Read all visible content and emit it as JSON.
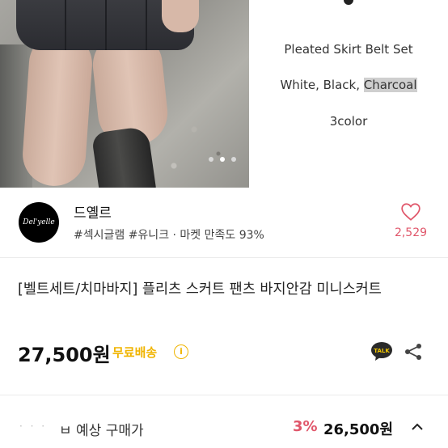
{
  "hero": {
    "info_line1": "Pleated Skirt Belt Set",
    "info_line2_prefix": "White, Black, ",
    "info_line2_highlight": "Charcoal",
    "info_line3": "3color",
    "carousel_dots": 3,
    "carousel_active_index": 1
  },
  "shop": {
    "avatar_text": "Del'yelle",
    "name": "드옐르",
    "tags": "#섹시글램 #유니크 · 마켓 만족도 93%",
    "like_count": "2,529"
  },
  "product": {
    "title": "[벨트세트/치마바지] 플리츠 스커트 팬츠 바지안감 미니스커트",
    "price": "27,500원",
    "shipping": "무료배송",
    "info_icon_label": "i",
    "talk_label": "TALK"
  },
  "purchase": {
    "coupon_placeholder": "·  ·  ·",
    "expected_label": "ㅂ 예상 구매가",
    "discount": "3%",
    "final_price": "26,500원"
  },
  "colors": {
    "accent_pink": "#e0566a",
    "shipping_yellow": "#f0b400",
    "talk_yellow": "#f2c700"
  }
}
